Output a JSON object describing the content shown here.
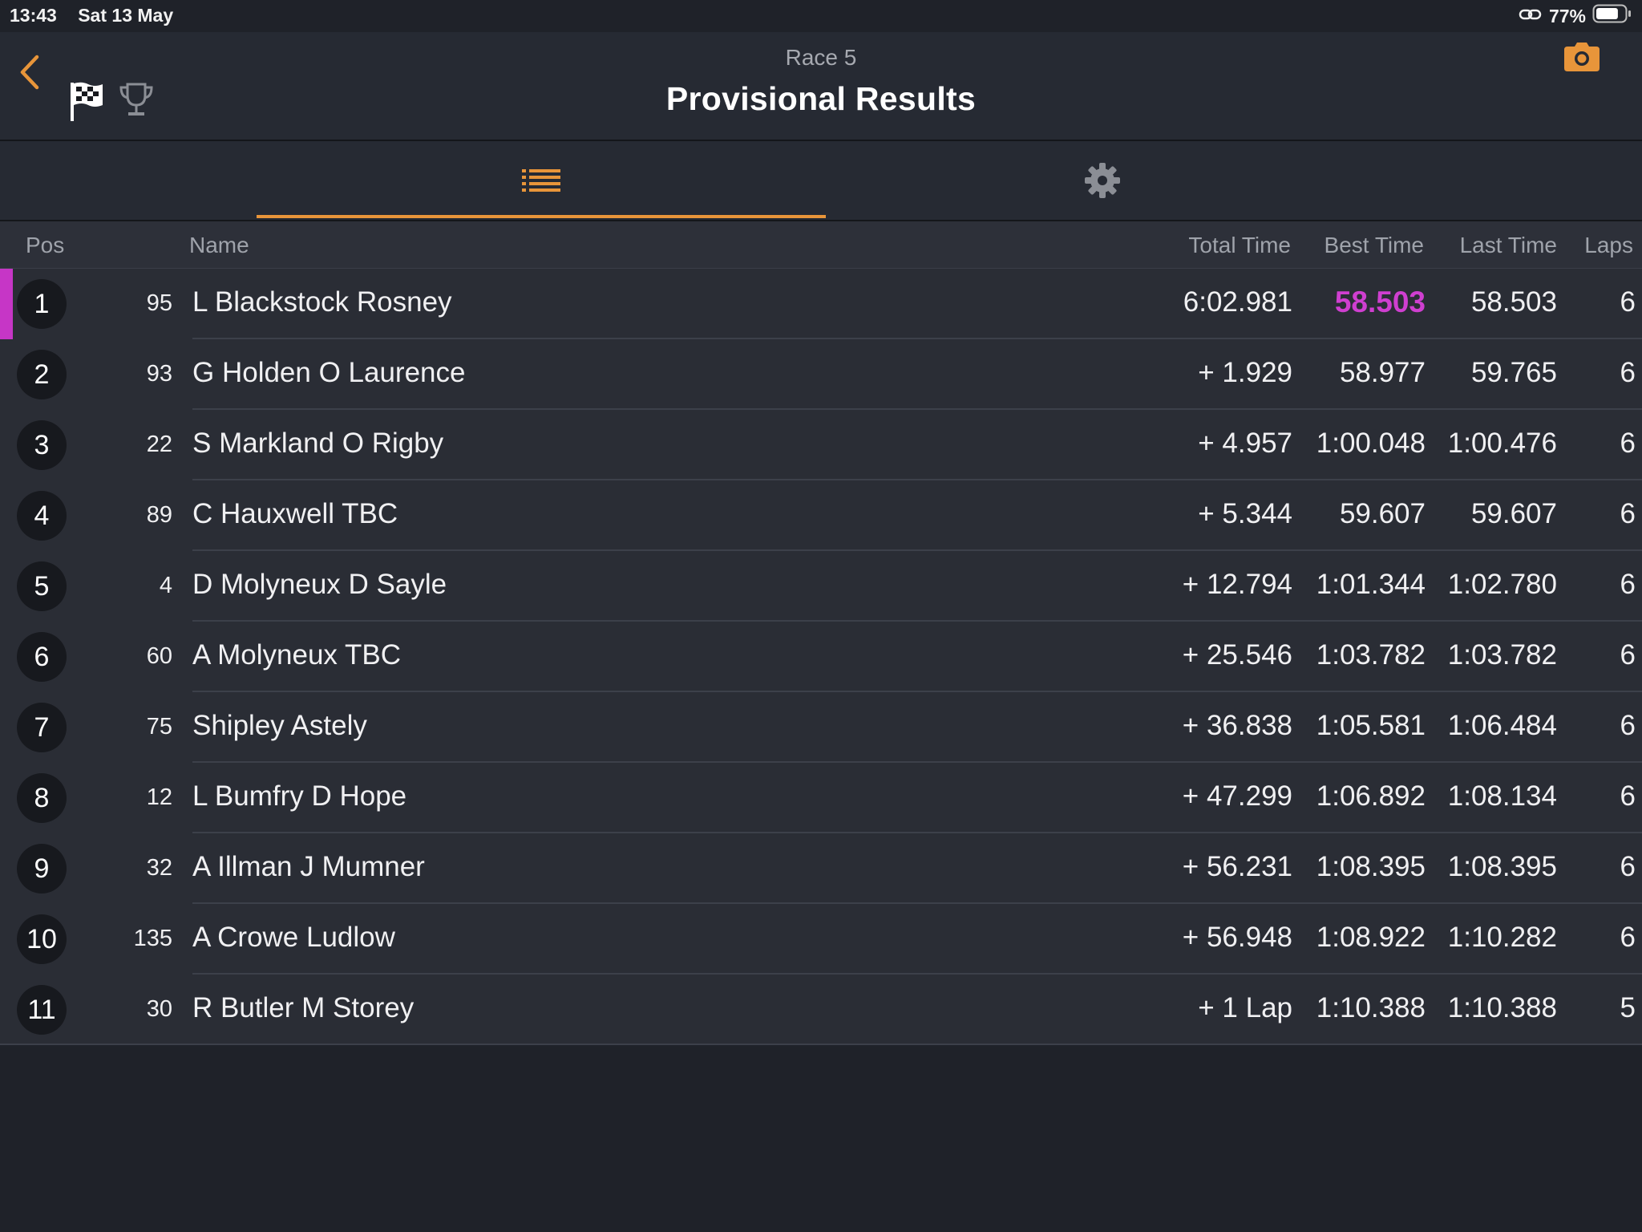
{
  "status_bar": {
    "time": "13:43",
    "date": "Sat 13 May",
    "battery_percent": "77%",
    "battery_level": 0.77
  },
  "header": {
    "subtitle": "Race 5",
    "title": "Provisional Results",
    "accent_color": "#e8953a"
  },
  "tabs": [
    {
      "icon": "list-icon",
      "selected": true
    },
    {
      "icon": "gear-icon",
      "selected": false
    }
  ],
  "table": {
    "columns": {
      "pos": "Pos",
      "name": "Name",
      "total_time": "Total Time",
      "best_time": "Best Time",
      "last_time": "Last Time",
      "laps": "Laps"
    },
    "rows": [
      {
        "pos": "1",
        "num": "95",
        "name": "L Blackstock Rosney",
        "total": "6:02.981",
        "best": "58.503",
        "last": "58.503",
        "laps": "6",
        "fastest_lap": true
      },
      {
        "pos": "2",
        "num": "93",
        "name": "G Holden O Laurence",
        "total": "+ 1.929",
        "best": "58.977",
        "last": "59.765",
        "laps": "6"
      },
      {
        "pos": "3",
        "num": "22",
        "name": "S Markland O Rigby",
        "total": "+ 4.957",
        "best": "1:00.048",
        "last": "1:00.476",
        "laps": "6"
      },
      {
        "pos": "4",
        "num": "89",
        "name": "C Hauxwell TBC",
        "total": "+ 5.344",
        "best": "59.607",
        "last": "59.607",
        "laps": "6"
      },
      {
        "pos": "5",
        "num": "4",
        "name": "D Molyneux D Sayle",
        "total": "+ 12.794",
        "best": "1:01.344",
        "last": "1:02.780",
        "laps": "6"
      },
      {
        "pos": "6",
        "num": "60",
        "name": "A Molyneux TBC",
        "total": "+ 25.546",
        "best": "1:03.782",
        "last": "1:03.782",
        "laps": "6"
      },
      {
        "pos": "7",
        "num": "75",
        "name": "Shipley Astely",
        "total": "+ 36.838",
        "best": "1:05.581",
        "last": "1:06.484",
        "laps": "6"
      },
      {
        "pos": "8",
        "num": "12",
        "name": "L Bumfry D Hope",
        "total": "+ 47.299",
        "best": "1:06.892",
        "last": "1:08.134",
        "laps": "6"
      },
      {
        "pos": "9",
        "num": "32",
        "name": "A Illman J Mumner",
        "total": "+ 56.231",
        "best": "1:08.395",
        "last": "1:08.395",
        "laps": "6"
      },
      {
        "pos": "10",
        "num": "135",
        "name": "A Crowe Ludlow",
        "total": "+ 56.948",
        "best": "1:08.922",
        "last": "1:10.282",
        "laps": "6"
      },
      {
        "pos": "11",
        "num": "30",
        "name": "R Butler M Storey",
        "total": "+ 1 Lap",
        "best": "1:10.388",
        "last": "1:10.388",
        "laps": "5"
      }
    ],
    "fastest_lap_color": "#cf3fd0"
  }
}
